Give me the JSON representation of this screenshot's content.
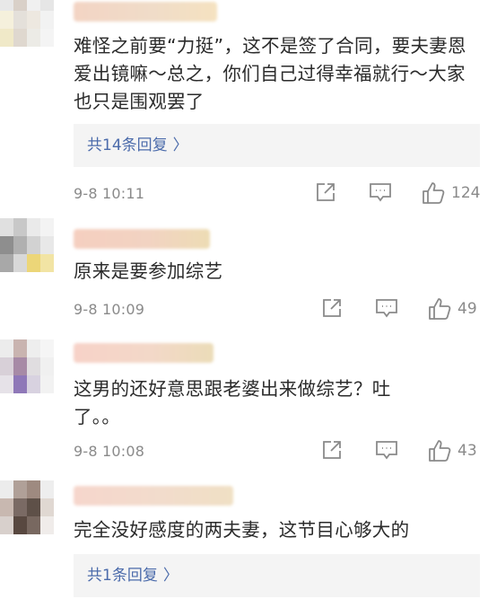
{
  "comments": [
    {
      "username": "用户名",
      "text": "难怪之前要“力挺”，这不是签了合同，要夫妻恩爱出镜嘛～总之，你们自己过得幸福就行～大家也只是围观罢了",
      "replies_label": "共14条回复",
      "timestamp": "9-8 10:11",
      "likes": "124",
      "avatar_colors": [
        "#e8e8e8",
        "#d9d0c8",
        "#f0f0f0",
        "#e6e6e6",
        "#f5f0dc",
        "#e4e0da",
        "#ede8e0",
        "#f2f2f2",
        "#f0e9c8",
        "#dfd8cf",
        "#ecebe6",
        "#f4f4f4"
      ],
      "name_colors": [
        "#f3d4c4",
        "#f0dcc8",
        "#f5e2c0"
      ]
    },
    {
      "username": "用户名",
      "text": "原来是要参加综艺",
      "timestamp": "9-8 10:09",
      "likes": "49",
      "avatar_colors": [
        "#e0e0e0",
        "#c8c8c8",
        "#eaeaea",
        "#f3f3f3",
        "#8e8e8e",
        "#b0b0b0",
        "#d2d2d2",
        "#e8e8e8",
        "#a8a8a8",
        "#d8d8d8",
        "#ecd678",
        "#f2e4a4"
      ],
      "name_colors": [
        "#f5cfc0",
        "#f2d3c2",
        "#eddcb4"
      ]
    },
    {
      "username": "用户名",
      "text": "这男的还好意思跟老婆出来做综艺？吐了。。",
      "timestamp": "9-8 10:08",
      "likes": "43",
      "avatar_colors": [
        "#ececec",
        "#c9b4b0",
        "#eeeeee",
        "#f5f5f5",
        "#d8d0d8",
        "#a78aa6",
        "#e0dde0",
        "#f0f0f0",
        "#e6e2e8",
        "#8f78b8",
        "#d8d2e0",
        "#f2f2f2"
      ],
      "name_colors": [
        "#f7d2c8",
        "#f3d8c8",
        "#ebdcb8"
      ]
    },
    {
      "username": "用户名",
      "text": "完全没好感度的两夫妻，这节目心够大的",
      "replies_label": "共1条回复",
      "avatar_colors": [
        "#ececec",
        "#b0a098",
        "#9e8a80",
        "#eeeeee",
        "#c8b8b0",
        "#7a6a64",
        "#5e5048",
        "#e0d8d2",
        "#d8d0cc",
        "#584840",
        "#786860",
        "#f0ecea"
      ],
      "name_colors": [
        "#f6d6cc",
        "#f2dccc",
        "#f0e0c4"
      ]
    }
  ],
  "icons": {
    "share": "share-icon",
    "comment": "comment-icon",
    "like": "thumbs-up-icon"
  },
  "colors": {
    "reply_link": "#4b6bab",
    "meta_text": "#8a8a8a",
    "reply_bg": "#f4f4f4"
  }
}
